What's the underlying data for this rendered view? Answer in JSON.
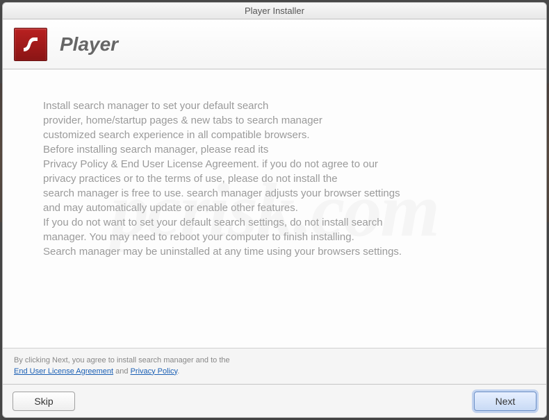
{
  "window": {
    "title": "Player Installer"
  },
  "header": {
    "title": "Player"
  },
  "body": {
    "text": "Install search manager to set your default search\nprovider, home/startup pages & new tabs to search manager\ncustomized search experience in all compatible browsers.\nBefore installing search manager, please read its\nPrivacy Policy & End User License Agreement. if you do not agree to our\nprivacy practices or to the terms of use, please do not install the\nsearch manager is free to use. search manager adjusts your browser settings\nand may automatically update or enable other features.\nIf you do not want to set your default search settings, do not install search\nmanager. You may need to reboot your computer to finish installing.\nSearch manager may be uninstalled at any time using your browsers settings."
  },
  "footer": {
    "prefix": "By clicking Next, you agree to install search manager and to the",
    "eula": "End User License Agreement",
    "and": " and ",
    "privacy": "Privacy Policy",
    "suffix": "."
  },
  "buttons": {
    "skip": "Skip",
    "next": "Next"
  },
  "watermark": "pcrisk.com"
}
